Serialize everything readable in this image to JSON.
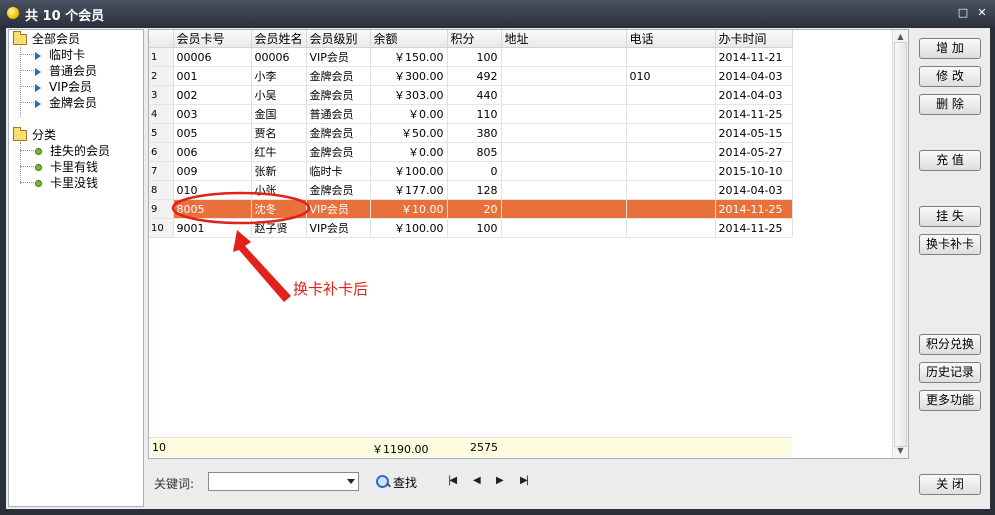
{
  "window": {
    "title": "共 10 个会员"
  },
  "tree": {
    "root_all": "全部会员",
    "levels": [
      "临时卡",
      "普通会员",
      "VIP会员",
      "金牌会员"
    ],
    "root_cat": "分类",
    "cats": [
      "挂失的会员",
      "卡里有钱",
      "卡里没钱"
    ]
  },
  "grid": {
    "headers": [
      "会员卡号",
      "会员姓名",
      "会员级别",
      "余额",
      "积分",
      "地址",
      "电话",
      "办卡时间"
    ],
    "rows": [
      {
        "n": "1",
        "card": "00006",
        "name": "00006",
        "level": "VIP会员",
        "bal": "￥150.00",
        "pts": "100",
        "addr": "",
        "tel": "",
        "date": "2014-11-21"
      },
      {
        "n": "2",
        "card": "001",
        "name": "小李",
        "level": "金牌会员",
        "bal": "￥300.00",
        "pts": "492",
        "addr": "",
        "tel": "010",
        "date": "2014-04-03"
      },
      {
        "n": "3",
        "card": "002",
        "name": "小吴",
        "level": "金牌会员",
        "bal": "￥303.00",
        "pts": "440",
        "addr": "",
        "tel": "",
        "date": "2014-04-03"
      },
      {
        "n": "4",
        "card": "003",
        "name": "金国",
        "level": "普通会员",
        "bal": "￥0.00",
        "pts": "110",
        "addr": "",
        "tel": "",
        "date": "2014-11-25"
      },
      {
        "n": "5",
        "card": "005",
        "name": "贾名",
        "level": "金牌会员",
        "bal": "￥50.00",
        "pts": "380",
        "addr": "",
        "tel": "",
        "date": "2014-05-15"
      },
      {
        "n": "6",
        "card": "006",
        "name": "红牛",
        "level": "金牌会员",
        "bal": "￥0.00",
        "pts": "805",
        "addr": "",
        "tel": "",
        "date": "2014-05-27"
      },
      {
        "n": "7",
        "card": "009",
        "name": "张新",
        "level": "临时卡",
        "bal": "￥100.00",
        "pts": "0",
        "addr": "",
        "tel": "",
        "date": "2015-10-10"
      },
      {
        "n": "8",
        "card": "010",
        "name": "小张",
        "level": "金牌会员",
        "bal": "￥177.00",
        "pts": "128",
        "addr": "",
        "tel": "",
        "date": "2014-04-03"
      },
      {
        "n": "9",
        "card": "8005",
        "name": "沈冬",
        "level": "VIP会员",
        "bal": "￥10.00",
        "pts": "20",
        "addr": "",
        "tel": "",
        "date": "2014-11-25"
      },
      {
        "n": "10",
        "card": "9001",
        "name": "赵子贤",
        "level": "VIP会员",
        "bal": "￥100.00",
        "pts": "100",
        "addr": "",
        "tel": "",
        "date": "2014-11-25"
      }
    ],
    "summary": {
      "count": "10",
      "balance": "￥1190.00",
      "points": "2575"
    },
    "selected_row": 9,
    "selected_color": "#e7703b"
  },
  "annotation": {
    "text": "换卡补卡后",
    "color": "#e0221a"
  },
  "search": {
    "label": "关键词:",
    "value": "",
    "find_label": "查找"
  },
  "nav": {
    "first": "|◀",
    "prev": "◀",
    "next": "▶",
    "last": "▶|"
  },
  "buttons": {
    "add": "增 加",
    "edit": "修 改",
    "delete": "删 除",
    "recharge": "充 值",
    "report_loss": "挂 失",
    "replace_card": "换卡补卡",
    "points_exchange": "积分兑换",
    "history": "历史记录",
    "more": "更多功能",
    "close": "关 闭"
  }
}
